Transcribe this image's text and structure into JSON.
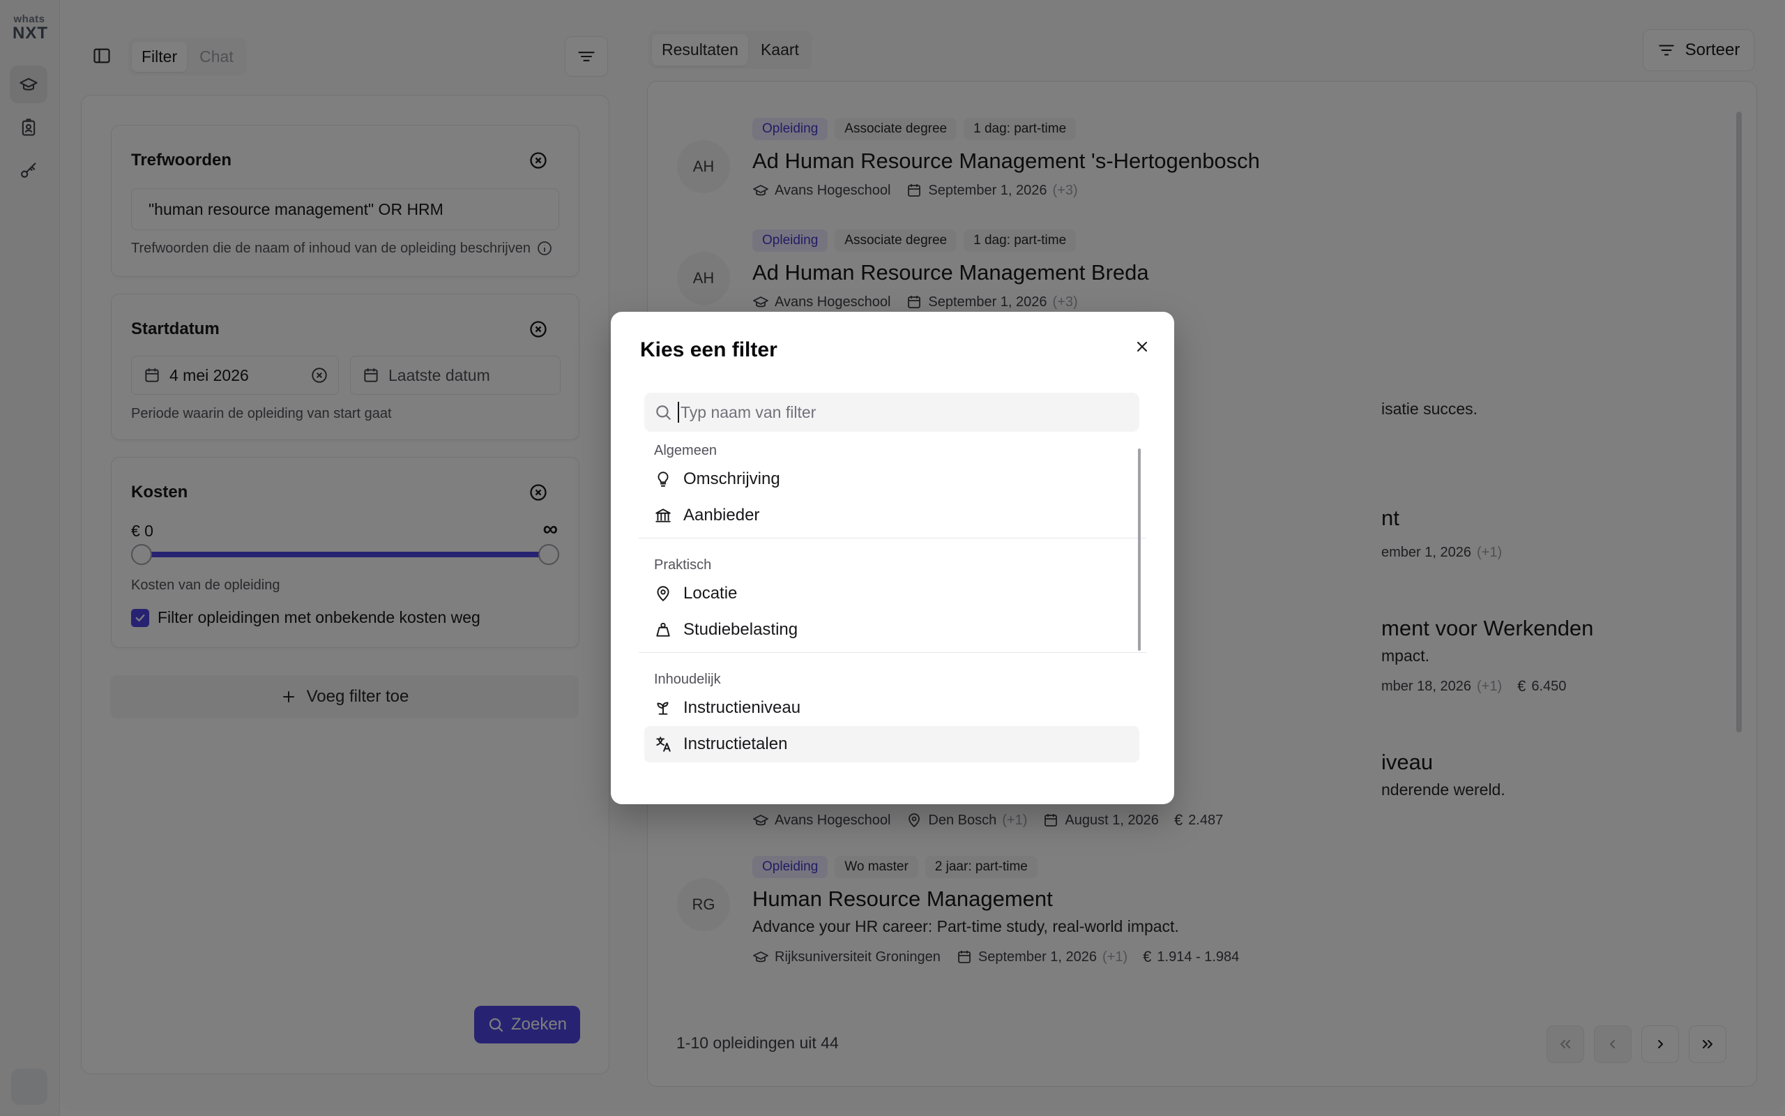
{
  "app": {
    "logo_top": "whats",
    "logo_bottom": "NXT"
  },
  "left": {
    "tabs": [
      "Filter",
      "Chat"
    ],
    "trefwoorden": {
      "title": "Trefwoorden",
      "value": "\"human resource management\" OR HRM",
      "hint": "Trefwoorden die de naam of inhoud van de opleiding beschrijven"
    },
    "startdatum": {
      "title": "Startdatum",
      "from_value": "4 mei 2026",
      "to_placeholder": "Laatste datum",
      "hint": "Periode waarin de opleiding van start gaat"
    },
    "kosten": {
      "title": "Kosten",
      "min_label": "€ 0",
      "max_label": "∞",
      "range_low": 0,
      "range_high": 1,
      "hint": "Kosten van de opleiding",
      "checkbox_label": "Filter opleidingen met onbekende kosten weg",
      "checkbox_checked": true
    },
    "add_filter_label": "Voeg filter toe",
    "search_button_label": "Zoeken"
  },
  "right": {
    "tabs": [
      "Resultaten",
      "Kaart"
    ],
    "sort_label": "Sorteer",
    "count_label": "1-10 opleidingen uit 44",
    "items": [
      {
        "initials": "AH",
        "badges": [
          "Opleiding",
          "Associate degree",
          "1 dag: part-time"
        ],
        "title": "Ad Human Resource Management 's-Hertogenbosch",
        "provider": "Avans Hogeschool",
        "date": "September 1, 2026",
        "date_more": "(+3)"
      },
      {
        "initials": "AH",
        "badges": [
          "Opleiding",
          "Associate degree",
          "1 dag: part-time"
        ],
        "title": "Ad Human Resource Management Breda",
        "provider": "Avans Hogeschool",
        "date": "September 1, 2026",
        "date_more": "(+3)"
      },
      {
        "desc_tail": "isatie succes."
      },
      {
        "title_tail": "nt",
        "date_tail": "ember 1, 2026",
        "date_more": "(+1)"
      },
      {
        "title_tail": "ment voor Werkenden",
        "desc_tail": "mpact.",
        "date_tail": "mber 18, 2026",
        "date_more": "(+1)",
        "cost": "6.450"
      },
      {
        "title_tail": "iveau",
        "desc_tail": "nderende wereld.",
        "provider": "Avans Hogeschool",
        "location": "Den Bosch",
        "location_more": "(+1)",
        "date": "August 1, 2026",
        "cost": "2.487"
      },
      {
        "initials": "RG",
        "badges": [
          "Opleiding",
          "Wo master",
          "2 jaar: part-time"
        ],
        "title": "Human Resource Management",
        "desc": "Advance your HR career: Part-time study, real-world impact.",
        "provider": "Rijksuniversiteit Groningen",
        "date": "September 1, 2026",
        "date_more": "(+1)",
        "cost": "1.914 - 1.984"
      }
    ]
  },
  "modal": {
    "title": "Kies een filter",
    "search_placeholder": "Typ naam van filter",
    "groups": [
      {
        "label": "Algemeen",
        "options": [
          {
            "label": "Omschrijving",
            "icon": "lightbulb-icon"
          },
          {
            "label": "Aanbieder",
            "icon": "bank-icon"
          }
        ]
      },
      {
        "label": "Praktisch",
        "options": [
          {
            "label": "Locatie",
            "icon": "map-pin-icon"
          },
          {
            "label": "Studiebelasting",
            "icon": "weight-icon"
          }
        ]
      },
      {
        "label": "Inhoudelijk",
        "options": [
          {
            "label": "Instructieniveau",
            "icon": "sprout-icon"
          },
          {
            "label": "Instructietalen",
            "icon": "languages-icon"
          }
        ]
      }
    ],
    "highlighted": "Instructietalen"
  },
  "colors": {
    "accent": "#4f46e5",
    "overlay": "rgba(0,0,0,0.5)"
  }
}
